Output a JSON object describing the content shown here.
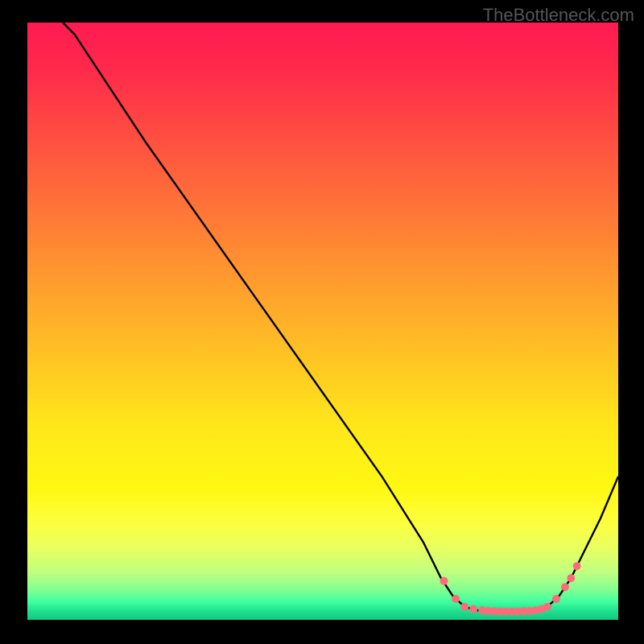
{
  "watermark": "TheBottleneck.com",
  "chart_data": {
    "type": "line",
    "title": "",
    "xlabel": "",
    "ylabel": "",
    "xlim": [
      0,
      100
    ],
    "ylim": [
      0,
      100
    ],
    "curve": [
      {
        "x": 6,
        "y": 100
      },
      {
        "x": 8,
        "y": 98
      },
      {
        "x": 12,
        "y": 92
      },
      {
        "x": 20,
        "y": 80
      },
      {
        "x": 30,
        "y": 66
      },
      {
        "x": 40,
        "y": 52
      },
      {
        "x": 50,
        "y": 38
      },
      {
        "x": 60,
        "y": 24
      },
      {
        "x": 67,
        "y": 13
      },
      {
        "x": 70,
        "y": 7
      },
      {
        "x": 72,
        "y": 4
      },
      {
        "x": 74,
        "y": 2.2
      },
      {
        "x": 76,
        "y": 1.6
      },
      {
        "x": 78,
        "y": 1.4
      },
      {
        "x": 80,
        "y": 1.4
      },
      {
        "x": 82,
        "y": 1.4
      },
      {
        "x": 84,
        "y": 1.4
      },
      {
        "x": 86,
        "y": 1.6
      },
      {
        "x": 88,
        "y": 2.2
      },
      {
        "x": 90,
        "y": 4
      },
      {
        "x": 92,
        "y": 7
      },
      {
        "x": 94,
        "y": 11
      },
      {
        "x": 97,
        "y": 17
      },
      {
        "x": 100,
        "y": 24
      }
    ],
    "markers": [
      {
        "x": 70.5,
        "y": 6.5
      },
      {
        "x": 72.5,
        "y": 3.5
      },
      {
        "x": 74,
        "y": 2.2
      },
      {
        "x": 75.5,
        "y": 1.8
      },
      {
        "x": 77,
        "y": 1.6
      },
      {
        "x": 78,
        "y": 1.5
      },
      {
        "x": 79,
        "y": 1.45
      },
      {
        "x": 80,
        "y": 1.4
      },
      {
        "x": 81,
        "y": 1.4
      },
      {
        "x": 82,
        "y": 1.4
      },
      {
        "x": 83,
        "y": 1.4
      },
      {
        "x": 84,
        "y": 1.45
      },
      {
        "x": 85,
        "y": 1.5
      },
      {
        "x": 86,
        "y": 1.6
      },
      {
        "x": 87,
        "y": 1.8
      },
      {
        "x": 88,
        "y": 2.2
      },
      {
        "x": 89.5,
        "y": 3.5
      },
      {
        "x": 91,
        "y": 5.5
      },
      {
        "x": 92,
        "y": 7
      },
      {
        "x": 93,
        "y": 9
      }
    ],
    "colors": {
      "curve_stroke": "#000000",
      "marker_fill": "#ff6b7a",
      "gradient_top": "#ff1a52",
      "gradient_bottom": "#10c880"
    }
  }
}
